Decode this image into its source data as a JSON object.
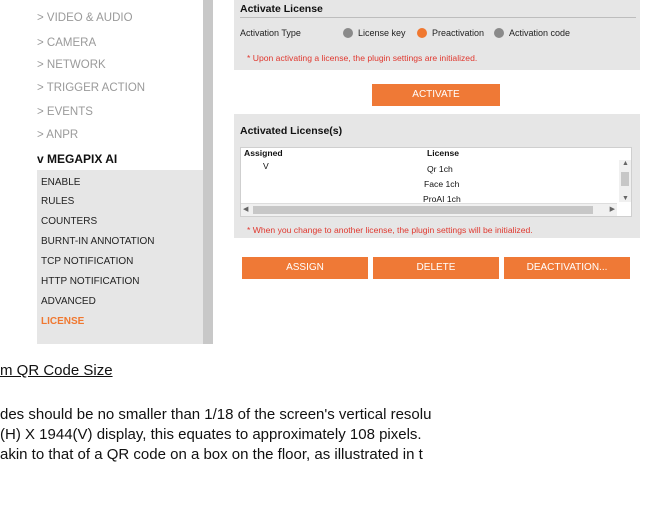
{
  "sidebar": {
    "items": [
      {
        "label": "> VIDEO & AUDIO"
      },
      {
        "label": "> CAMERA"
      },
      {
        "label": "> NETWORK"
      },
      {
        "label": "> TRIGGER ACTION"
      },
      {
        "label": "> EVENTS"
      },
      {
        "label": "> ANPR"
      }
    ],
    "active": {
      "label": "v MEGAPIX AI"
    },
    "submenu": [
      {
        "label": "ENABLE"
      },
      {
        "label": "RULES"
      },
      {
        "label": "COUNTERS"
      },
      {
        "label": "BURNT-IN ANNOTATION"
      },
      {
        "label": "TCP NOTIFICATION"
      },
      {
        "label": "HTTP NOTIFICATION"
      },
      {
        "label": "ADVANCED"
      },
      {
        "label": "LICENSE"
      }
    ]
  },
  "activate_panel": {
    "title": "Activate License",
    "type_label": "Activation Type",
    "options": [
      "License key",
      "Preactivation",
      "Activation code"
    ],
    "selected": "Preactivation",
    "warning": "* Upon activating a license, the plugin settings are initialized."
  },
  "activate_button": "ACTIVATE",
  "licenses_panel": {
    "title": "Activated License(s)",
    "columns": [
      "Assigned",
      "License"
    ],
    "rows": [
      {
        "assigned": "V",
        "license": "Qr 1ch"
      },
      {
        "assigned": "",
        "license": "Face 1ch"
      },
      {
        "assigned": "",
        "license": "ProAI 1ch"
      }
    ],
    "warning": "* When you change to another license, the plugin settings will be initialized."
  },
  "buttons": {
    "assign": "ASSIGN",
    "delete": "DELETE",
    "deactivation": "DEACTIVATION..."
  },
  "document": {
    "heading": "m QR Code Size",
    "lines": [
      "des should be no smaller than 1/18 of the screen's vertical resolu",
      "(H) X 1944(V) display, this equates to approximately 108 pixels.",
      "akin to that of a QR code on a box on the floor, as illustrated in t"
    ]
  },
  "colors": {
    "accent": "#ef7936",
    "panel": "#e6e6e6",
    "warning": "#e0382f"
  }
}
